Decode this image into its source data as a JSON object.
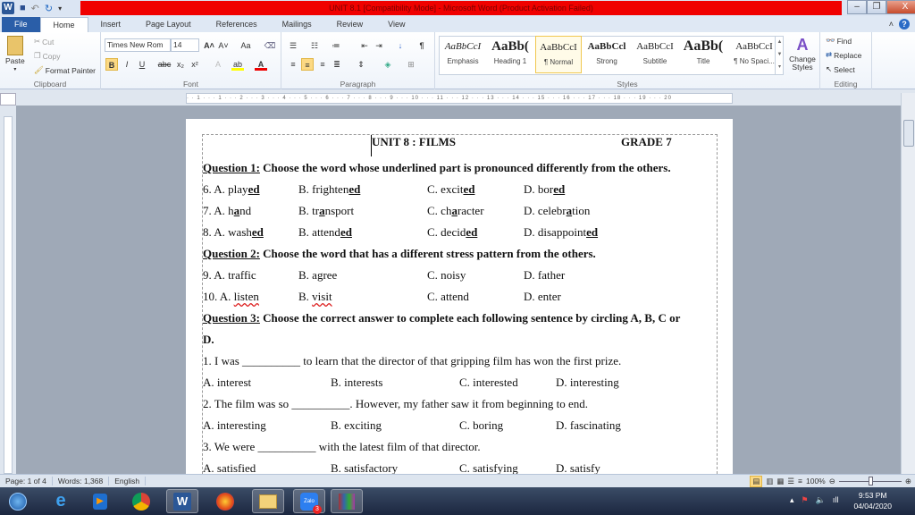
{
  "window": {
    "title": "UNIT 8.1 [Compatibility Mode]  -  Microsoft Word (Product Activation Failed)",
    "minimize": "–",
    "restore": "❐",
    "close": "X"
  },
  "tabs": [
    "File",
    "Home",
    "Insert",
    "Page Layout",
    "References",
    "Mailings",
    "Review",
    "View"
  ],
  "ribbon": {
    "clipboard": {
      "label": "Clipboard",
      "paste": "Paste",
      "cut": "Cut",
      "copy": "Copy",
      "format_painter": "Format Painter"
    },
    "font": {
      "label": "Font",
      "font_name": "Times New Rom",
      "font_size": "14",
      "grow": "A˄",
      "shrink": "A˅",
      "case": "Aa",
      "bold": "B",
      "italic": "I",
      "underline": "U",
      "strike": "abc",
      "sub": "x₂",
      "sup": "x²",
      "highlight": "ab",
      "color": "A"
    },
    "paragraph": {
      "label": "Paragraph",
      "pilcrow": "¶"
    },
    "styles": {
      "label": "Styles",
      "items": [
        {
          "preview": "AaBbCcI",
          "name": "Emphasis"
        },
        {
          "preview": "AaBb(",
          "name": "Heading 1"
        },
        {
          "preview": "AaBbCcI",
          "name": "¶ Normal"
        },
        {
          "preview": "AaBbCcl",
          "name": "Strong"
        },
        {
          "preview": "AaBbCcI",
          "name": "Subtitle"
        },
        {
          "preview": "AaBb(",
          "name": "Title"
        },
        {
          "preview": "AaBbCcI",
          "name": "¶ No Spaci..."
        }
      ],
      "change_styles": "Change Styles"
    },
    "editing": {
      "label": "Editing",
      "find": "Find",
      "replace": "Replace",
      "select": "Select"
    }
  },
  "ruler": "· · 1 · · · 1 · · · 2 · · · 3 · · · 4 · · · 5 · · · 6 · · · 7 · · · 8 · · · 9 · · · 10 · · · 11 · · · 12 · · · 13 · · · 14 · · · 15 · · · 16 · · · 17 · · · 18 · · · 19 · · · 20",
  "doc": {
    "header_left": "UNIT 8 : FILMS",
    "header_right": "GRADE 7",
    "lines": [
      {
        "type": "heading",
        "label": "Question 1:",
        "text": " Choose the word whose underlined part is pronounced differently from the others."
      },
      {
        "type": "opts",
        "layout": "a",
        "cols": [
          [
            [
              "6. A. play",
              ""
            ],
            [
              "ed",
              "b u"
            ]
          ],
          [
            [
              "B. frighten",
              ""
            ],
            [
              "ed",
              "b u"
            ]
          ],
          [
            [
              "C. excit",
              ""
            ],
            [
              "ed",
              "b u"
            ]
          ],
          [
            [
              "D. bor",
              ""
            ],
            [
              "ed",
              "b u"
            ]
          ]
        ]
      },
      {
        "type": "opts",
        "layout": "a",
        "cols": [
          [
            [
              "7. A. h",
              ""
            ],
            [
              "a",
              "b u"
            ],
            [
              "nd",
              ""
            ]
          ],
          [
            [
              "B. tr",
              ""
            ],
            [
              "a",
              "b u"
            ],
            [
              "nsport",
              ""
            ]
          ],
          [
            [
              "C. ch",
              ""
            ],
            [
              "a",
              "b u"
            ],
            [
              "racter",
              ""
            ]
          ],
          [
            [
              "D. celebr",
              ""
            ],
            [
              "a",
              "b u"
            ],
            [
              "tion",
              ""
            ]
          ]
        ]
      },
      {
        "type": "opts",
        "layout": "a",
        "cols": [
          [
            [
              "8. A. wash",
              ""
            ],
            [
              "ed",
              "b u"
            ]
          ],
          [
            [
              "B. attend",
              ""
            ],
            [
              "ed",
              "b u"
            ]
          ],
          [
            [
              "C. decid",
              ""
            ],
            [
              "ed",
              "b u"
            ]
          ],
          [
            [
              "D. disappoint",
              ""
            ],
            [
              "ed",
              "b u"
            ]
          ]
        ]
      },
      {
        "type": "heading",
        "label": "Question 2:",
        "text": " Choose the word that has a different stress pattern from the others."
      },
      {
        "type": "opts",
        "layout": "a",
        "cols": [
          [
            [
              "9. A. traffic",
              ""
            ]
          ],
          [
            [
              "B. agree",
              ""
            ]
          ],
          [
            [
              "C. noisy",
              ""
            ]
          ],
          [
            [
              "D. father",
              ""
            ]
          ]
        ]
      },
      {
        "type": "opts",
        "layout": "a",
        "cols": [
          [
            [
              "10. A. ",
              ""
            ],
            [
              "listen",
              "s"
            ]
          ],
          [
            [
              "B. ",
              ""
            ],
            [
              "visit",
              "s"
            ]
          ],
          [
            [
              "C. attend",
              ""
            ]
          ],
          [
            [
              "D. enter",
              ""
            ]
          ]
        ]
      },
      {
        "type": "heading",
        "label": "Question 3:",
        "text": " Choose the correct answer to complete each following sentence by circling A, B, C or"
      },
      {
        "type": "bold",
        "text": "D."
      },
      {
        "type": "text",
        "text": "1. I was __________ to learn that the director of that gripping film has won the first prize."
      },
      {
        "type": "opts",
        "layout": "b",
        "cols": [
          [
            [
              "A. interest",
              ""
            ]
          ],
          [
            [
              "B. interests",
              ""
            ]
          ],
          [
            [
              "C. interested",
              ""
            ]
          ],
          [
            [
              "D. interesting",
              ""
            ]
          ]
        ]
      },
      {
        "type": "text",
        "text": "2. The film was so __________. However, my father saw it from beginning to end."
      },
      {
        "type": "opts",
        "layout": "b",
        "cols": [
          [
            [
              "A. interesting",
              ""
            ]
          ],
          [
            [
              "B. exciting",
              ""
            ]
          ],
          [
            [
              "C. boring",
              ""
            ]
          ],
          [
            [
              "D. fascinating",
              ""
            ]
          ]
        ]
      },
      {
        "type": "text",
        "text": "3. We were __________ with the latest film of that director."
      },
      {
        "type": "opts",
        "layout": "b",
        "cols": [
          [
            [
              "A. satisfied",
              ""
            ]
          ],
          [
            [
              "B. satisfactory",
              ""
            ]
          ],
          [
            [
              "C. satisfying",
              ""
            ]
          ],
          [
            [
              "D. satisfy",
              ""
            ]
          ]
        ]
      }
    ]
  },
  "status": {
    "page": "Page: 1 of 4",
    "words": "Words: 1,368",
    "language": "English",
    "zoom": "100%"
  },
  "taskbar": {
    "apps": [
      "start",
      "internet-explorer",
      "media-player",
      "chrome",
      "word",
      "firefox",
      "file-explorer",
      "zalo",
      "winrar"
    ],
    "zalo_badge": "3",
    "time": "9:53 PM",
    "date": "04/04/2020"
  }
}
